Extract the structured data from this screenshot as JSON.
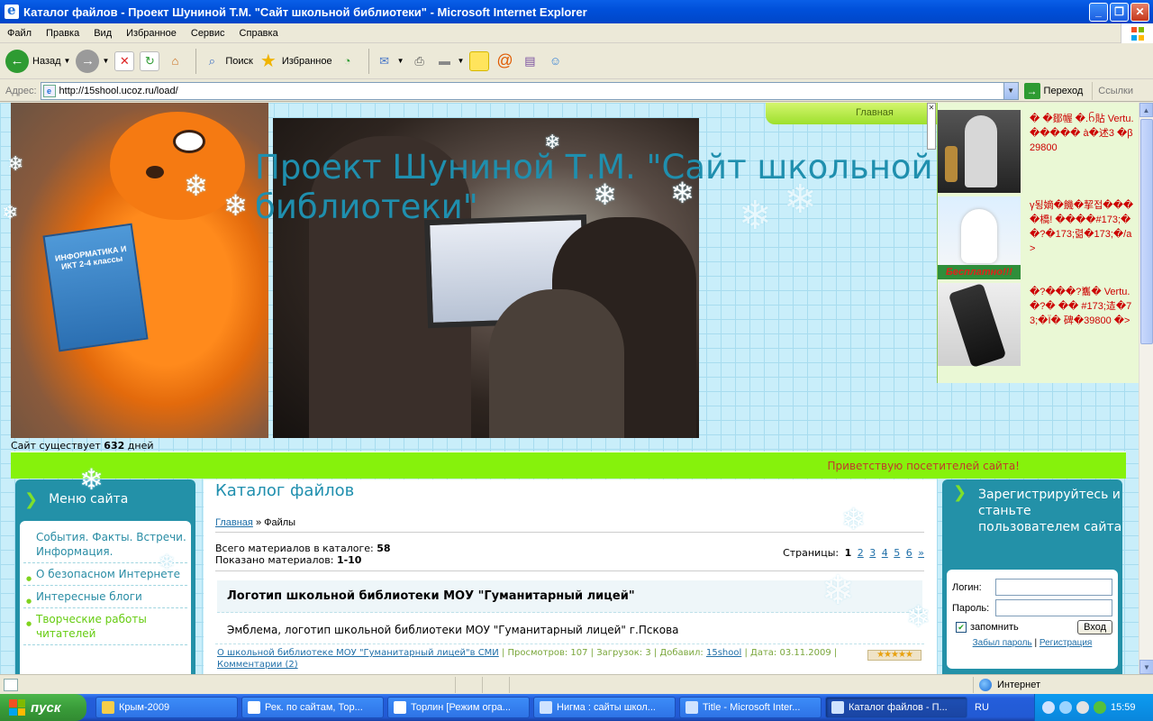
{
  "window": {
    "title": "Каталог файлов - Проект Шуниной Т.М. \"Сайт школьной библиотеки\" - Microsoft Internet Explorer"
  },
  "menu": [
    "Файл",
    "Правка",
    "Вид",
    "Избранное",
    "Сервис",
    "Справка"
  ],
  "toolbar": {
    "back": "Назад",
    "search": "Поиск",
    "favorites": "Избранное"
  },
  "address": {
    "label": "Адрес:",
    "url": "http://15shool.ucoz.ru/load/",
    "go": "Переход",
    "links": "Ссылки"
  },
  "page": {
    "site_title": "Проект Шуниной Т.М. \"Сайт школьной библиотеки\"",
    "nav_home": "Главная",
    "book_text": "ИНФОРМАТИКА И ИКТ 2-4 классы",
    "exists_prefix": "Сайт существует",
    "exists_days": "632",
    "exists_suffix": "дней",
    "greeting": "Приветствую посетителей сайта!",
    "ads": [
      {
        "text": "� �鄒幄 �.ᨤ貼 Vertu. ����� à�述3 �β 29800"
      },
      {
        "text": "γ됭嫡�饑�挈접��� �橋! ����#173;��?�173;렮�173;�/a>"
      },
      {
        "text": "�?���?雟� Vertu. �?� �� #173;迼�73;�Ï� 碑�39800 �>"
      }
    ],
    "left_menu": {
      "title": "Меню сайта",
      "items": [
        "События. Факты. Встречи. Информация.",
        "О безопасном Интернете",
        "Интересные блоги",
        "Творческие работы читателей"
      ]
    },
    "center": {
      "heading": "Каталог файлов",
      "crumb_home": "Главная",
      "crumb_sep": "»",
      "crumb_current": "Файлы",
      "total_label": "Всего материалов в каталоге:",
      "total_value": "58",
      "shown_label": "Показано материалов:",
      "shown_value": "1-10",
      "pages_label": "Страницы:",
      "pages": [
        "1",
        "2",
        "3",
        "4",
        "5",
        "6",
        "»"
      ],
      "entry": {
        "title": "Логотип школьной библиотеки МОУ \"Гуманитарный лицей\"",
        "description": "Эмблема, логотип школьной библиотеки МОУ \"Гуманитарный лицей\" г.Пскова",
        "category": "О школьной библиотеке МОУ \"Гуманитарный лицей\"в СМИ",
        "views": "Просмотров: 107",
        "downloads": "Загрузок: 3",
        "added_label": "Добавил:",
        "added_by": "15shool",
        "date": "Дата: 03.11.2009",
        "comments": "Комментарии (2)",
        "rating": 5
      }
    },
    "login": {
      "title": "Зарегистрируйтесь и станьте пользователем сайта",
      "login_label": "Логин:",
      "password_label": "Пароль:",
      "remember": "запомнить",
      "submit": "Вход",
      "forgot": "Забыл пароль",
      "sep": "|",
      "register": "Регистрация"
    }
  },
  "status": {
    "zone": "Интернет"
  },
  "taskbar": {
    "start": "пуск",
    "tasks": [
      "Крым-2009",
      "Рек. по сайтам, Тор...",
      "Торлин [Режим огра...",
      "Нигма : сайты школ...",
      "Title - Microsoft Inter...",
      "Каталог файлов - П..."
    ],
    "lang": "RU",
    "time": "15:59"
  }
}
